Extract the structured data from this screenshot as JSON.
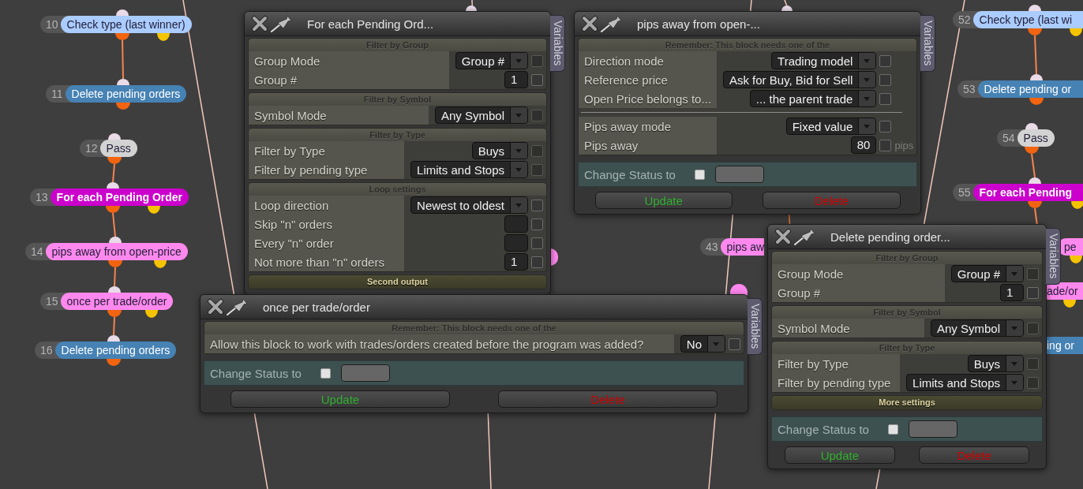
{
  "columns": [
    {
      "nodes": [
        {
          "number": "10",
          "label": "Check type (last winner)",
          "kind": "condition",
          "color": "#aaccff",
          "linked_from_above": false,
          "second_output": true
        },
        {
          "number": "11",
          "label": "Delete pending orders",
          "kind": "action",
          "color": "#4682b4",
          "linked_from_above": true,
          "second_output": false
        },
        {
          "number": "12",
          "label": "Pass",
          "kind": "pass",
          "color": "#d3d3d3",
          "linked_from_above": false,
          "second_output": false
        },
        {
          "number": "13",
          "label": "For each Pending Order",
          "kind": "loop",
          "color": "#cc00cc",
          "linked_from_above": true,
          "second_output": true
        },
        {
          "number": "14",
          "label": "pips away from open-price",
          "kind": "filter",
          "color": "#ff88ee",
          "linked_from_above": true,
          "second_output": true
        },
        {
          "number": "15",
          "label": "once per trade/order",
          "kind": "filter",
          "color": "#ff88ee",
          "linked_from_above": true,
          "second_output": true
        },
        {
          "number": "16",
          "label": "Delete pending orders",
          "kind": "action",
          "color": "#4682b4",
          "linked_from_above": true,
          "second_output": false
        }
      ]
    },
    {
      "nodes": [
        {
          "kind": "filter",
          "color": "#ff88ee"
        }
      ]
    },
    {
      "nodes": [
        {
          "number": "43",
          "label": "pips aw",
          "kind": "filter",
          "color": "#ff88ee"
        },
        {
          "kind": "filter",
          "color": "#ff88ee"
        }
      ]
    },
    {
      "nodes": [
        {
          "number": "52",
          "label": "Check type (last wi",
          "kind": "condition",
          "color": "#aaccff",
          "linked_from_above": false,
          "second_output": true
        },
        {
          "number": "53",
          "label": "Delete pending or",
          "kind": "action",
          "color": "#4682b4",
          "linked_from_above": true,
          "second_output": false
        },
        {
          "number": "54",
          "label": "Pass",
          "kind": "pass",
          "color": "#d3d3d3",
          "linked_from_above": false,
          "second_output": false
        },
        {
          "number": "55",
          "label": "For each Pending",
          "kind": "loop",
          "color": "#cc00cc",
          "linked_from_above": true,
          "second_output": true
        },
        {
          "label": "pe",
          "kind": "filter",
          "color": "#ff88ee",
          "linked_from_above": true,
          "second_output": true
        },
        {
          "label": "ade/or",
          "kind": "filter",
          "color": "#ff88ee",
          "second_output": true
        },
        {
          "label": "ing or",
          "kind": "action",
          "color": "#4682b4"
        }
      ]
    }
  ],
  "windows": [
    {
      "title": "For each Pending Ord...",
      "tab": "Variables",
      "sections": [
        {
          "heading": "Filter by Group",
          "expanded": true,
          "rows": [
            {
              "kind": "dropdown",
              "label": "Group Mode",
              "value": "Group #",
              "checkbox": {
                "checked": false,
                "disabled": true
              }
            },
            {
              "kind": "number",
              "label": "Group #",
              "value": "1",
              "checkbox": {
                "checked": false,
                "disabled": false
              }
            }
          ]
        },
        {
          "heading": "Filter by Symbol",
          "expanded": true,
          "rows": [
            {
              "kind": "dropdown",
              "label": "Symbol Mode",
              "value": "Any Symbol",
              "checkbox": {
                "checked": false,
                "disabled": true
              }
            }
          ]
        },
        {
          "heading": "Filter by Type",
          "expanded": true,
          "rows": [
            {
              "kind": "dropdown",
              "label": "Filter by Type",
              "value": "Buys",
              "checkbox": {
                "checked": false,
                "disabled": true
              }
            },
            {
              "kind": "dropdown",
              "label": "Filter by pending type",
              "value": "Limits and Stops",
              "checkbox": {
                "checked": false,
                "disabled": true
              }
            }
          ]
        },
        {
          "heading": "Loop settings",
          "expanded": true,
          "rows": [
            {
              "kind": "dropdown",
              "label": "Loop direction",
              "value": "Newest to oldest",
              "checkbox": {
                "checked": false,
                "disabled": false
              }
            },
            {
              "kind": "number",
              "label": "Skip \"n\" orders",
              "checkbox": {
                "checked": false,
                "disabled": false
              }
            },
            {
              "kind": "number",
              "label": "Every \"n\" order",
              "checkbox": {
                "checked": false,
                "disabled": false
              }
            },
            {
              "kind": "number",
              "label": "Not more than \"n\" orders",
              "value": "1",
              "checkbox": {
                "checked": false,
                "disabled": false
              }
            }
          ]
        },
        {
          "heading": "Second output",
          "expanded": false
        }
      ]
    },
    {
      "title": "pips away from open-...",
      "tab": "Variables",
      "sections": [
        {
          "heading": "Remember: This block needs one of the",
          "expanded": true,
          "rows": [
            {
              "kind": "dropdown",
              "label": "Direction mode",
              "value": "Trading model",
              "checkbox": {
                "checked": false,
                "disabled": false
              }
            },
            {
              "kind": "dropdown",
              "label": "Reference price",
              "value": "Ask for Buy, Bid for Sell",
              "checkbox": {
                "checked": false,
                "disabled": false
              }
            },
            {
              "kind": "dropdown",
              "label": "Open Price belongs to...",
              "value": "... the parent trade",
              "checkbox": {
                "checked": false,
                "disabled": false
              }
            },
            {
              "kind": "separator"
            },
            {
              "kind": "dropdown",
              "label": "Pips away mode",
              "value": "Fixed value",
              "checkbox": {
                "checked": false,
                "disabled": false
              }
            },
            {
              "kind": "number",
              "label": "Pips away",
              "value": "80",
              "unit": "pips",
              "checkbox": {
                "checked": false,
                "disabled": false
              }
            }
          ]
        }
      ],
      "status": {
        "label": "Change Status to",
        "checked": false
      },
      "buttons": [
        {
          "kind": "update",
          "label": "Update"
        },
        {
          "kind": "delete",
          "label": "Delete"
        }
      ]
    },
    {
      "title": "once per trade/order",
      "tab": "Variables",
      "sections": [
        {
          "heading": "Remember: This block needs one of the",
          "expanded": true,
          "rows": [
            {
              "kind": "dropdown",
              "label": "Allow this block to work with trades/orders created before the program was added?",
              "value": "No",
              "checkbox": {
                "checked": false,
                "disabled": false
              }
            }
          ]
        }
      ],
      "status": {
        "label": "Change Status to",
        "checked": false
      },
      "buttons": [
        {
          "kind": "update",
          "label": "Update"
        },
        {
          "kind": "delete",
          "label": "Delete"
        }
      ]
    },
    {
      "title": "Delete pending order...",
      "tab": "Variables",
      "sections": [
        {
          "heading": "Filter by Group",
          "expanded": true,
          "rows": [
            {
              "kind": "dropdown",
              "label": "Group Mode",
              "value": "Group #",
              "checkbox": {
                "checked": false,
                "disabled": true
              }
            },
            {
              "kind": "number",
              "label": "Group #",
              "value": "1",
              "checkbox": {
                "checked": false,
                "disabled": false
              }
            }
          ]
        },
        {
          "heading": "Filter by Symbol",
          "expanded": true,
          "rows": [
            {
              "kind": "dropdown",
              "label": "Symbol Mode",
              "value": "Any Symbol",
              "checkbox": {
                "checked": false,
                "disabled": true
              }
            }
          ]
        },
        {
          "heading": "Filter by Type",
          "expanded": true,
          "rows": [
            {
              "kind": "dropdown",
              "label": "Filter by Type",
              "value": "Buys",
              "checkbox": {
                "checked": false,
                "disabled": true
              }
            },
            {
              "kind": "dropdown",
              "label": "Filter by pending type",
              "value": "Limits and Stops",
              "checkbox": {
                "checked": false,
                "disabled": true
              }
            }
          ]
        },
        {
          "heading": "More settings",
          "expanded": false
        }
      ],
      "status": {
        "label": "Change Status to",
        "checked": false
      },
      "buttons": [
        {
          "kind": "update",
          "label": "Update"
        },
        {
          "kind": "delete",
          "label": "Delete"
        }
      ]
    }
  ]
}
